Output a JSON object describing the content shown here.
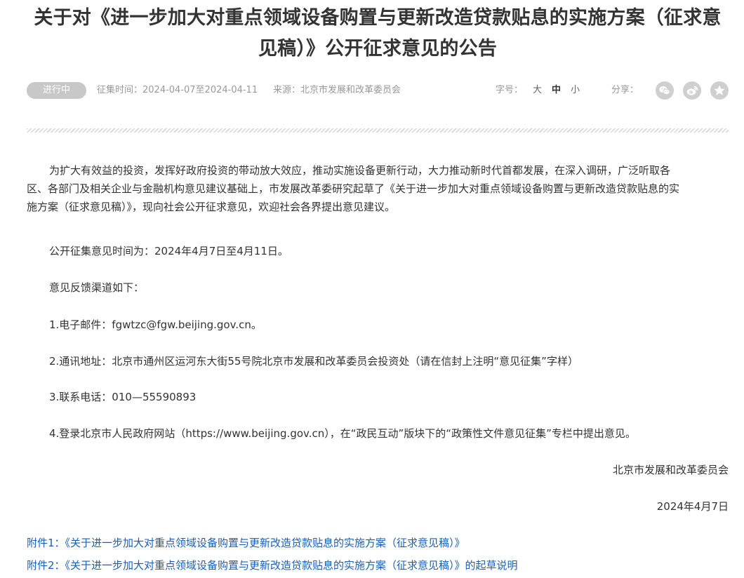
{
  "title": "关于对《进一步加大对重点领域设备购置与更新改造贷款贴息的实施方案（征求意见稿）》公开征求意见的公告",
  "meta": {
    "status": "进行中",
    "period": "征集时间：2024-04-07至2024-04-11",
    "source": "来源：北京市发展和改革委员会",
    "font_size_label": "字号：",
    "font_sizes": [
      "大",
      "中",
      "小"
    ],
    "font_size_selected": "中",
    "share_label": "分享：",
    "share_icons": [
      "wechat-icon",
      "weibo-icon",
      "qzone-icon"
    ]
  },
  "body": {
    "intro_lines": [
      "为扩大有效益的投资，发挥好政府投资的带动放大效应，推动实施设备更新行动，大力推动新时代首都发展，在深入调研，广泛听取各",
      "区、各部门及相关企业与金融机构意见建议基础上，市发展改革委研究起草了《关于进一步加大对重点领域设备购置与更新改造贷款贴息的实",
      "施方案（征求意见稿）》，现向社会公开征求意见，欢迎社会各界提出意见建议。"
    ],
    "period_line": "公开征集意见时间为：2024年4月7日至4月11日。",
    "channels_heading": "意见反馈渠道如下：",
    "channels": [
      "1.电子邮件：fgwtzc@fgw.beijing.gov.cn。",
      "2.通讯地址：北京市通州区运河东大街55号院北京市发展和改革委员会投资处（请在信封上注明“意见征集”字样）",
      "3.联系电话：010—55590893",
      "4.登录北京市人民政府网站（https://www.beijing.gov.cn），在“政民互动”版块下的“政策性文件意见征集”专栏中提出意见。"
    ],
    "signature": "北京市发展和改革委员会",
    "date": "2024年4月7日"
  },
  "attachments": [
    "附件1：《关于进一步加大对重点领域设备购置与更新改造贷款贴息的实施方案（征求意见稿）》",
    "附件2：《关于进一步加大对重点领域设备购置与更新改造贷款贴息的实施方案（征求意见稿）》的起草说明"
  ],
  "colors": {
    "text": "#333333",
    "meta_text": "#999999",
    "badge_bg": "#c8c8c8",
    "link": "#1a5fb4",
    "share_icon_bg": "#cfcfcf"
  }
}
